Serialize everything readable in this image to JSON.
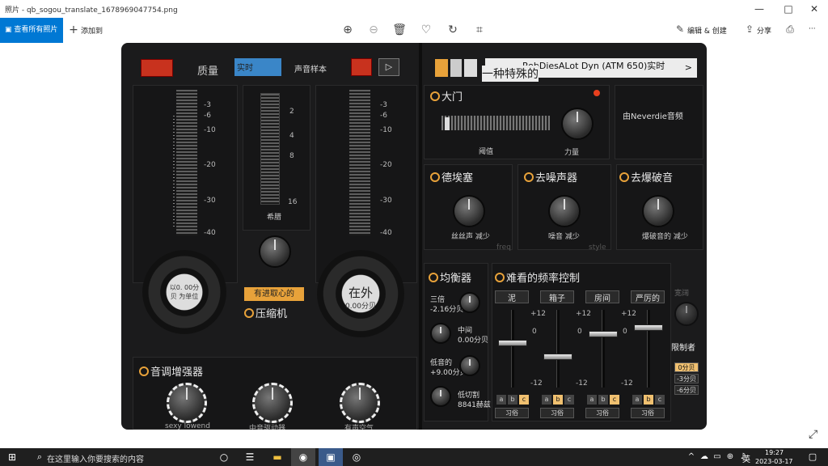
{
  "titlebar": {
    "title": "照片 - qb_sogou_translate_1678969047754.png",
    "min": "—",
    "max": "□",
    "close": "✕"
  },
  "toolbar": {
    "all_photos": "查看所有照片",
    "add_to": "添加到",
    "edit_create": "编辑 & 创建",
    "share": "分享",
    "zoom_in_icon": "zoom-in-icon",
    "zoom_out_icon": "zoom-out-icon",
    "delete_icon": "trash-icon",
    "favorite_icon": "heart-icon",
    "rotate_icon": "rotate-icon",
    "crop_icon": "crop-icon",
    "print_icon": "printer-icon",
    "more": "···"
  },
  "plugin": {
    "top": {
      "quality": "质量",
      "realtime": "实时",
      "voice_sample": "声音样本",
      "preset": "RobDiesALot Dyn (ATM 650)实时",
      "special": "一种特殊的",
      "arrow": ">"
    },
    "gate": {
      "title": "大门",
      "by": "由Neverdie音频",
      "threshold": "阈值",
      "power": "力量"
    },
    "left_meter_ticks": [
      "-3",
      "-6",
      "-10",
      "-20",
      "-30",
      "-40"
    ],
    "right_meter_ticks": [
      "-3",
      "-6",
      "-10",
      "-20",
      "-30",
      "-40"
    ],
    "mid_meter_ticks": [
      "2",
      "4",
      "8",
      "16"
    ],
    "mid_meter_label": "希腊",
    "input_dial": "以0. 00分贝 为单位",
    "output_dial_top": "在外",
    "output_dial_val": "0.00分贝",
    "compressor_tag": "有进取心的",
    "compressor": "压缩机",
    "deesser": {
      "title": "德埃塞",
      "sub": "丝丝声 减少",
      "freq": "freq"
    },
    "denoise": {
      "title": "去噪声器",
      "sub": "噪音 减少",
      "style": "style"
    },
    "declick": {
      "title": "去爆破音",
      "sub": "爆破音的 减少"
    },
    "eq": {
      "title": "均衡器",
      "treble": "三倍",
      "treble_val": "-2.16分贝",
      "mid": "中间",
      "mid_val": "0.00分贝",
      "bass": "低音的",
      "bass_val": "+9.00分贝",
      "lowcut": "低切割",
      "lowcut_val": "8841赫兹"
    },
    "ugly": {
      "title": "难看的频率控制",
      "bands": [
        "泥",
        "箱子",
        "房间",
        "严厉的"
      ],
      "p12": "+12",
      "zero": "0",
      "m12": "-12",
      "abc": [
        "a",
        "b",
        "c"
      ],
      "custom": "习俗"
    },
    "limiter": {
      "title": "限制者",
      "width": "宽阔",
      "opts": [
        "0分贝",
        "-3分贝",
        "-6分贝"
      ]
    },
    "tone": {
      "title": "音调增强器",
      "k1": "sexy lowend",
      "k2": "中音驱动器",
      "k3": "有声空气"
    }
  },
  "taskbar": {
    "search": "在这里输入你要搜索的内容",
    "time": "19:27",
    "date": "2023-03-17",
    "lang": "英"
  }
}
